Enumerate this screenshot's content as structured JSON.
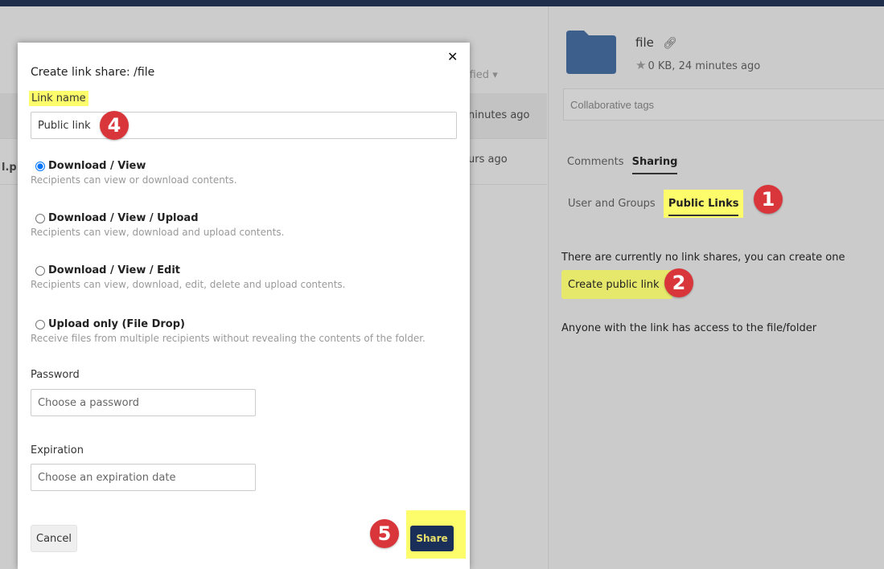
{
  "file_list": {
    "column_modified": "ified",
    "rows": [
      {
        "name": "",
        "modified": "ninutes ago"
      },
      {
        "name": "l.p",
        "modified": "urs ago"
      }
    ]
  },
  "sidebar": {
    "file_name": "file",
    "file_meta": "0 KB, 24 minutes ago",
    "tags_placeholder": "Collaborative tags",
    "tabs": [
      "Comments",
      "Sharing"
    ],
    "subtabs": [
      "User and Groups",
      "Public Links"
    ],
    "no_shares_text": "There are currently no link shares, you can create one",
    "create_link_label": "Create public link",
    "access_note": "Anyone with the link has access to the file/folder"
  },
  "modal": {
    "title": "Create link share: /file",
    "link_name_label": "Link name",
    "link_name_value": "Public link",
    "options": [
      {
        "label": "Download / View",
        "desc": "Recipients can view or download contents."
      },
      {
        "label": "Download / View / Upload",
        "desc": "Recipients can view, download and upload contents."
      },
      {
        "label": "Download / View / Edit",
        "desc": "Recipients can view, download, edit, delete and upload contents."
      },
      {
        "label": "Upload only (File Drop)",
        "desc": "Receive files from multiple recipients without revealing the contents of the folder."
      }
    ],
    "selected_option": "Download / View",
    "password_label": "Password",
    "password_placeholder": "Choose a password",
    "expiration_label": "Expiration",
    "expiration_placeholder": "Choose an expiration date",
    "cancel_label": "Cancel",
    "share_label": "Share"
  },
  "annotations": [
    "1",
    "2",
    "4",
    "5"
  ],
  "colors": {
    "highlight": "#fdfd6c",
    "badge": "#d9363b",
    "primary_button": "#1a2e5a",
    "folder": "#3d5f8c"
  }
}
